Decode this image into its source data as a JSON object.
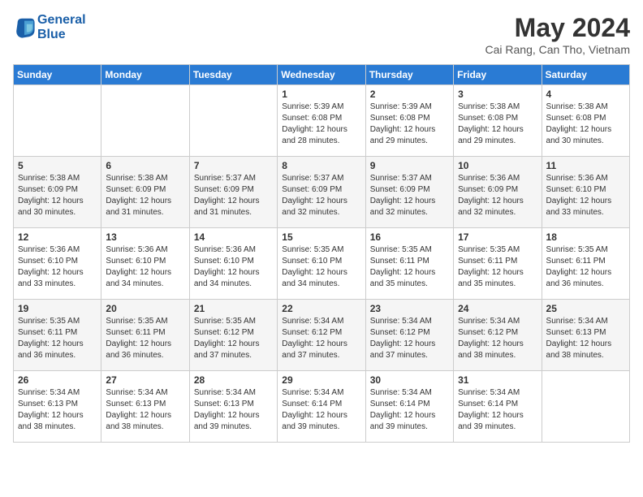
{
  "header": {
    "logo_line1": "General",
    "logo_line2": "Blue",
    "month": "May 2024",
    "location": "Cai Rang, Can Tho, Vietnam"
  },
  "weekdays": [
    "Sunday",
    "Monday",
    "Tuesday",
    "Wednesday",
    "Thursday",
    "Friday",
    "Saturday"
  ],
  "weeks": [
    [
      {
        "day": "",
        "info": ""
      },
      {
        "day": "",
        "info": ""
      },
      {
        "day": "",
        "info": ""
      },
      {
        "day": "1",
        "info": "Sunrise: 5:39 AM\nSunset: 6:08 PM\nDaylight: 12 hours\nand 28 minutes."
      },
      {
        "day": "2",
        "info": "Sunrise: 5:39 AM\nSunset: 6:08 PM\nDaylight: 12 hours\nand 29 minutes."
      },
      {
        "day": "3",
        "info": "Sunrise: 5:38 AM\nSunset: 6:08 PM\nDaylight: 12 hours\nand 29 minutes."
      },
      {
        "day": "4",
        "info": "Sunrise: 5:38 AM\nSunset: 6:08 PM\nDaylight: 12 hours\nand 30 minutes."
      }
    ],
    [
      {
        "day": "5",
        "info": "Sunrise: 5:38 AM\nSunset: 6:09 PM\nDaylight: 12 hours\nand 30 minutes."
      },
      {
        "day": "6",
        "info": "Sunrise: 5:38 AM\nSunset: 6:09 PM\nDaylight: 12 hours\nand 31 minutes."
      },
      {
        "day": "7",
        "info": "Sunrise: 5:37 AM\nSunset: 6:09 PM\nDaylight: 12 hours\nand 31 minutes."
      },
      {
        "day": "8",
        "info": "Sunrise: 5:37 AM\nSunset: 6:09 PM\nDaylight: 12 hours\nand 32 minutes."
      },
      {
        "day": "9",
        "info": "Sunrise: 5:37 AM\nSunset: 6:09 PM\nDaylight: 12 hours\nand 32 minutes."
      },
      {
        "day": "10",
        "info": "Sunrise: 5:36 AM\nSunset: 6:09 PM\nDaylight: 12 hours\nand 32 minutes."
      },
      {
        "day": "11",
        "info": "Sunrise: 5:36 AM\nSunset: 6:10 PM\nDaylight: 12 hours\nand 33 minutes."
      }
    ],
    [
      {
        "day": "12",
        "info": "Sunrise: 5:36 AM\nSunset: 6:10 PM\nDaylight: 12 hours\nand 33 minutes."
      },
      {
        "day": "13",
        "info": "Sunrise: 5:36 AM\nSunset: 6:10 PM\nDaylight: 12 hours\nand 34 minutes."
      },
      {
        "day": "14",
        "info": "Sunrise: 5:36 AM\nSunset: 6:10 PM\nDaylight: 12 hours\nand 34 minutes."
      },
      {
        "day": "15",
        "info": "Sunrise: 5:35 AM\nSunset: 6:10 PM\nDaylight: 12 hours\nand 34 minutes."
      },
      {
        "day": "16",
        "info": "Sunrise: 5:35 AM\nSunset: 6:11 PM\nDaylight: 12 hours\nand 35 minutes."
      },
      {
        "day": "17",
        "info": "Sunrise: 5:35 AM\nSunset: 6:11 PM\nDaylight: 12 hours\nand 35 minutes."
      },
      {
        "day": "18",
        "info": "Sunrise: 5:35 AM\nSunset: 6:11 PM\nDaylight: 12 hours\nand 36 minutes."
      }
    ],
    [
      {
        "day": "19",
        "info": "Sunrise: 5:35 AM\nSunset: 6:11 PM\nDaylight: 12 hours\nand 36 minutes."
      },
      {
        "day": "20",
        "info": "Sunrise: 5:35 AM\nSunset: 6:11 PM\nDaylight: 12 hours\nand 36 minutes."
      },
      {
        "day": "21",
        "info": "Sunrise: 5:35 AM\nSunset: 6:12 PM\nDaylight: 12 hours\nand 37 minutes."
      },
      {
        "day": "22",
        "info": "Sunrise: 5:34 AM\nSunset: 6:12 PM\nDaylight: 12 hours\nand 37 minutes."
      },
      {
        "day": "23",
        "info": "Sunrise: 5:34 AM\nSunset: 6:12 PM\nDaylight: 12 hours\nand 37 minutes."
      },
      {
        "day": "24",
        "info": "Sunrise: 5:34 AM\nSunset: 6:12 PM\nDaylight: 12 hours\nand 38 minutes."
      },
      {
        "day": "25",
        "info": "Sunrise: 5:34 AM\nSunset: 6:13 PM\nDaylight: 12 hours\nand 38 minutes."
      }
    ],
    [
      {
        "day": "26",
        "info": "Sunrise: 5:34 AM\nSunset: 6:13 PM\nDaylight: 12 hours\nand 38 minutes."
      },
      {
        "day": "27",
        "info": "Sunrise: 5:34 AM\nSunset: 6:13 PM\nDaylight: 12 hours\nand 38 minutes."
      },
      {
        "day": "28",
        "info": "Sunrise: 5:34 AM\nSunset: 6:13 PM\nDaylight: 12 hours\nand 39 minutes."
      },
      {
        "day": "29",
        "info": "Sunrise: 5:34 AM\nSunset: 6:14 PM\nDaylight: 12 hours\nand 39 minutes."
      },
      {
        "day": "30",
        "info": "Sunrise: 5:34 AM\nSunset: 6:14 PM\nDaylight: 12 hours\nand 39 minutes."
      },
      {
        "day": "31",
        "info": "Sunrise: 5:34 AM\nSunset: 6:14 PM\nDaylight: 12 hours\nand 39 minutes."
      },
      {
        "day": "",
        "info": ""
      }
    ]
  ]
}
